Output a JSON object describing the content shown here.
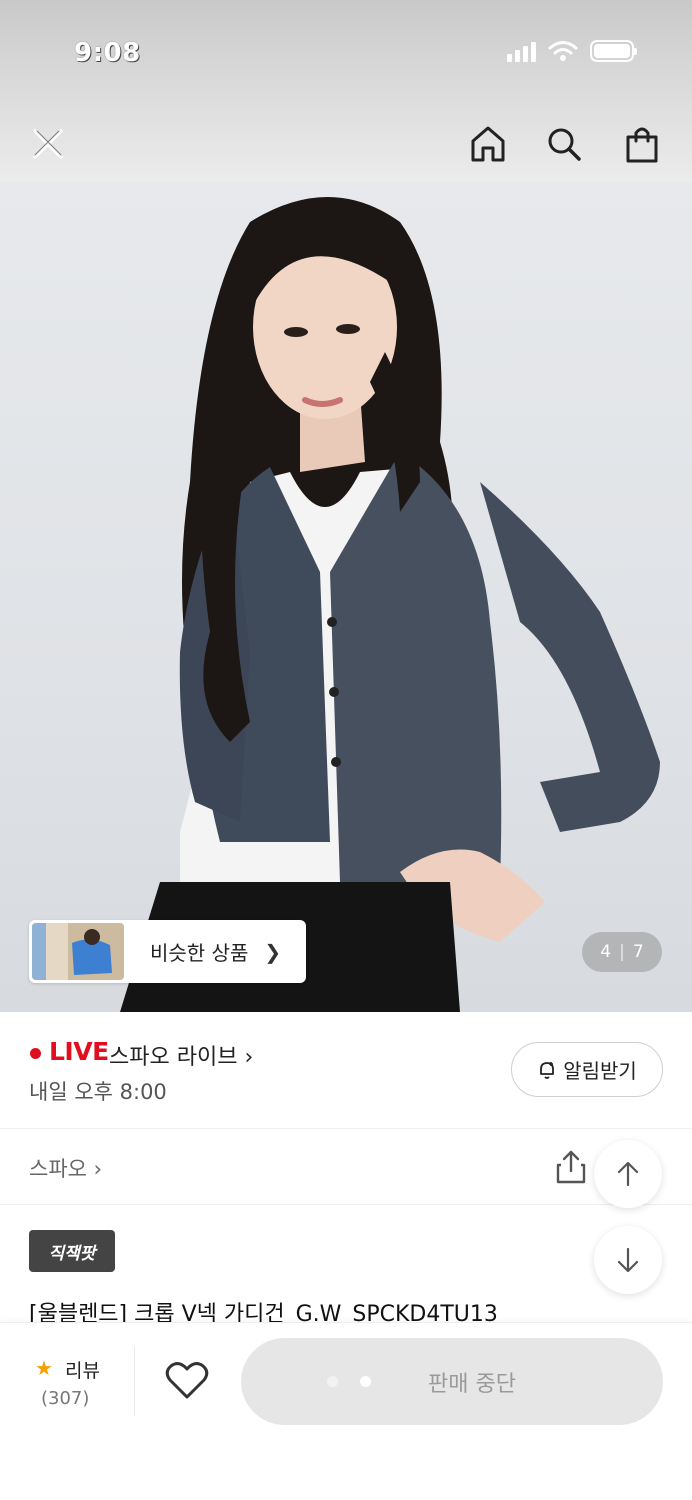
{
  "status_bar": {
    "time": "9:08"
  },
  "nav": {
    "close_icon": "close-icon",
    "home_icon": "home-icon",
    "search_icon": "search-icon",
    "cart_icon": "shopping-bag-icon"
  },
  "gallery": {
    "similar_label": "비슷한 상품",
    "current_page": "4",
    "total_pages": "7"
  },
  "live": {
    "badge": "LIVE",
    "channel": "스파오 라이브",
    "schedule": "내일 오후 8:00",
    "notify_label": "알림받기"
  },
  "product": {
    "brand": "스파오",
    "badge": "직잭팟",
    "title": "[울블렌드] 크롭 V넥 가디건_G.W_SPCKD4TU13"
  },
  "bottom": {
    "review_label": "리뷰",
    "review_count": "(307)",
    "action_label": "판매 중단"
  },
  "colors": {
    "live_red": "#e00f1f",
    "star_orange": "#f5a100",
    "disabled_button": "#e6e6e6"
  }
}
